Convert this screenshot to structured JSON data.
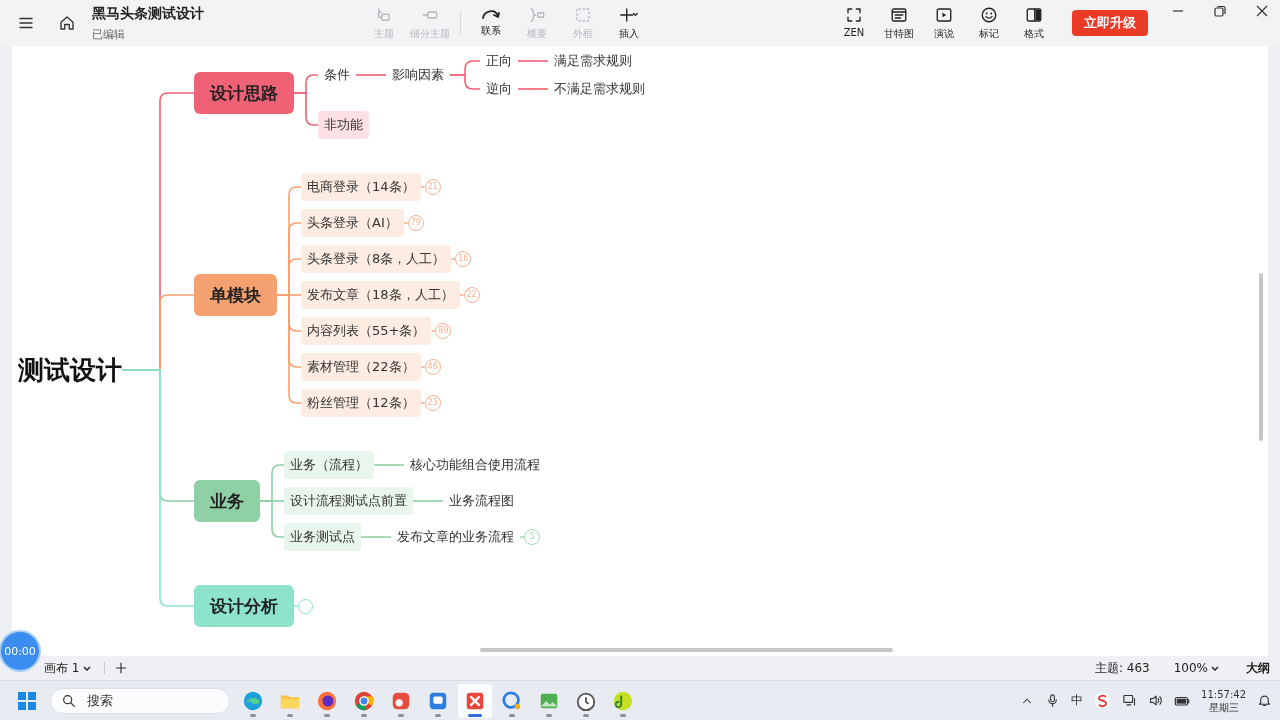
{
  "app": {
    "title": "黑马头条测试设计",
    "save_status": "已编辑"
  },
  "toolbar": [
    {
      "label": "主题",
      "disabled": true
    },
    {
      "label": "细分主题",
      "disabled": true
    },
    {
      "label": "联系",
      "disabled": false
    },
    {
      "label": "概要",
      "disabled": true
    },
    {
      "label": "外框",
      "disabled": true
    },
    {
      "label": "插入",
      "disabled": false
    }
  ],
  "view_tools": [
    {
      "label": "ZEN"
    },
    {
      "label": "甘特图"
    },
    {
      "label": "演说"
    },
    {
      "label": "标记"
    },
    {
      "label": "格式"
    }
  ],
  "upgrade_button": "立即升级",
  "map": {
    "root": {
      "text": "测试设计",
      "kind": "root"
    },
    "branches": [
      {
        "text": "设计思路",
        "kind": "main",
        "color": "#ef6275",
        "children": [
          {
            "text": "条件",
            "kind": "text",
            "children": [
              {
                "text": "影响因素",
                "kind": "text",
                "children": [
                  {
                    "text": "正向",
                    "kind": "text",
                    "children": [
                      {
                        "text": "满足需求规则",
                        "kind": "text"
                      }
                    ]
                  },
                  {
                    "text": "逆向",
                    "kind": "text",
                    "children": [
                      {
                        "text": "不满足需求规则",
                        "kind": "text"
                      }
                    ]
                  }
                ]
              }
            ]
          },
          {
            "text": "非功能",
            "kind": "sub"
          }
        ]
      },
      {
        "text": "单模块",
        "kind": "main",
        "color": "#f5a070",
        "children": [
          {
            "text": "电商登录（14条）",
            "kind": "sub",
            "count": "21"
          },
          {
            "text": "头条登录（AI）",
            "kind": "sub",
            "count": "79"
          },
          {
            "text": "头条登录（8条，人工）",
            "kind": "sub",
            "count": "16"
          },
          {
            "text": "发布文章（18条，人工）",
            "kind": "sub",
            "count": "22"
          },
          {
            "text": "内容列表（55+条）",
            "kind": "sub",
            "count": "89"
          },
          {
            "text": "素材管理（22条）",
            "kind": "sub",
            "count": "46"
          },
          {
            "text": "粉丝管理（12条）",
            "kind": "sub",
            "count": "23"
          }
        ]
      },
      {
        "text": "业务",
        "kind": "main",
        "color": "#8fd1a5",
        "children": [
          {
            "text": "业务（流程）",
            "kind": "sub",
            "children": [
              {
                "text": "核心功能组合使用流程",
                "kind": "text"
              }
            ]
          },
          {
            "text": "设计流程测试点前置",
            "kind": "sub",
            "children": [
              {
                "text": "业务流程图",
                "kind": "text"
              }
            ]
          },
          {
            "text": "业务测试点",
            "kind": "sub",
            "children": [
              {
                "text": "发布文章的业务流程",
                "kind": "text",
                "count": "5"
              }
            ]
          }
        ]
      },
      {
        "text": "设计分析",
        "kind": "main",
        "color": "#8de3cc",
        "collapsed": true
      }
    ]
  },
  "timer": "00:00",
  "status_bar": {
    "sheet_tab": "画布 1",
    "topics": "主题: 463",
    "zoom": "100%",
    "outline": "大纲"
  },
  "taskbar": {
    "search_placeholder": "搜索",
    "apps": [
      {
        "selected": false
      },
      {
        "selected": false
      },
      {
        "selected": false
      },
      {
        "selected": false
      },
      {
        "selected": false
      },
      {
        "selected": false
      },
      {
        "selected": true
      },
      {
        "selected": false
      },
      {
        "selected": false
      },
      {
        "selected": false
      },
      {
        "selected": false
      }
    ],
    "ime": "中",
    "time": "11:57:42",
    "day": "星期三"
  }
}
